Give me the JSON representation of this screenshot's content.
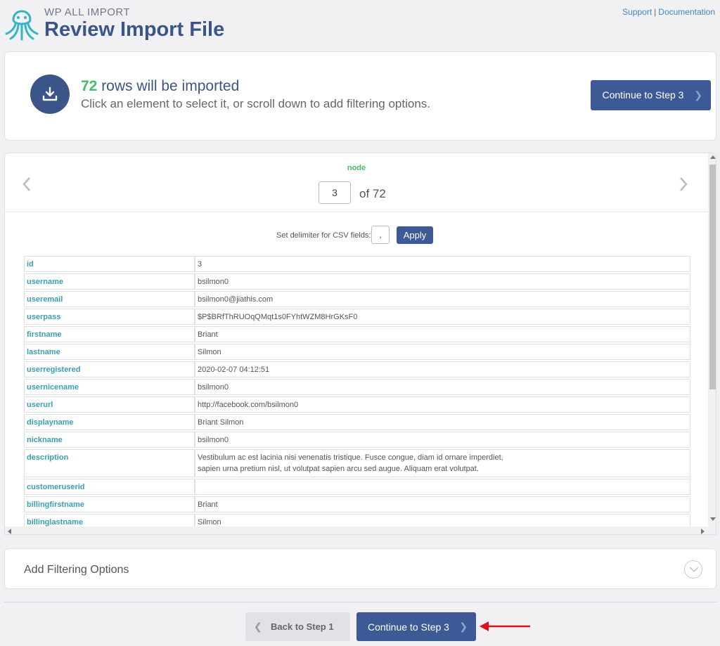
{
  "header": {
    "brand": "WP ALL IMPORT",
    "title": "Review Import File",
    "links": [
      "Support",
      "Documentation"
    ],
    "separator": "|"
  },
  "summary": {
    "count": "72",
    "line1_suffix": " rows will be imported",
    "line2": "Click an element to select it, or scroll down to add filtering options.",
    "continue_label": "Continue to Step 3"
  },
  "navigator": {
    "node_label": "node",
    "current": "3",
    "of_text": "of 72"
  },
  "delimiter": {
    "label": "Set delimiter for CSV fields:",
    "value": ",",
    "apply_label": "Apply"
  },
  "record": [
    {
      "key": "id",
      "value": "3"
    },
    {
      "key": "username",
      "value": "bsilmon0"
    },
    {
      "key": "useremail",
      "value": "bsilmon0@jiathis.com"
    },
    {
      "key": "userpass",
      "value": "$P$BRfThRUOqQMqt1s0FYhtWZM8HrGKsF0"
    },
    {
      "key": "firstname",
      "value": "Briant"
    },
    {
      "key": "lastname",
      "value": "Silmon"
    },
    {
      "key": "userregistered",
      "value": "2020-02-07 04:12:51"
    },
    {
      "key": "usernicename",
      "value": "bsilmon0"
    },
    {
      "key": "userurl",
      "value": "http://facebook.com/bsilmon0"
    },
    {
      "key": "displayname",
      "value": "Briant Silmon"
    },
    {
      "key": "nickname",
      "value": "bsilmon0"
    },
    {
      "key": "description",
      "value": "Vestibulum ac est lacinia nisi venenatis tristique. Fusce congue, diam id ornare imperdiet,",
      "value2": "sapien urna pretium nisl, ut volutpat sapien arcu sed augue. Aliquam erat volutpat."
    },
    {
      "key": "customeruserid",
      "value": ""
    },
    {
      "key": "billingfirstname",
      "value": "Briant"
    },
    {
      "key": "billinglastname",
      "value": "Silmon"
    }
  ],
  "filtering": {
    "title": "Add Filtering Options"
  },
  "footer": {
    "back_label": "Back to Step 1",
    "continue_label": "Continue to Step 3"
  },
  "colors": {
    "accent": "#3d5a96",
    "count_green": "#46ba69",
    "key_teal": "#3a9fb2",
    "annotation_arrow": "#e0101a"
  },
  "icons": {
    "logo": "octopus-logo-icon",
    "download": "download-icon",
    "prev": "chevron-left-icon",
    "next": "chevron-right-icon",
    "expand": "chevron-down-icon",
    "annotation": "red-arrow-icon"
  }
}
